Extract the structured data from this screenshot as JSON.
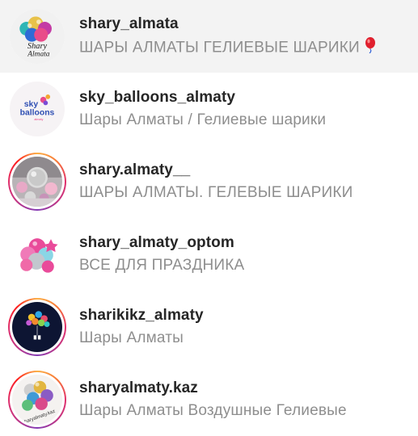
{
  "results": [
    {
      "username": "shary_almata",
      "subtitle": "ШАРЫ АЛМАТЫ ГЕЛИЕВЫЕ ШАРИКИ",
      "has_emoji": true,
      "emoji_icon": "red-balloon-icon",
      "story_ring": false,
      "highlighted": true,
      "avatar_text_lines": [
        "Shary",
        "Almata"
      ]
    },
    {
      "username": "sky_balloons_almaty",
      "subtitle": "Шары Алматы / Гелиевые шарики",
      "has_emoji": false,
      "story_ring": false,
      "highlighted": false,
      "avatar_text_lines": [
        "sky",
        "balloons",
        "almaty"
      ]
    },
    {
      "username": "shary.almaty__",
      "subtitle": "ШАРЫ АЛМАТЫ. ГЕЛЕВЫЕ ШАРИКИ",
      "has_emoji": false,
      "story_ring": true,
      "highlighted": false
    },
    {
      "username": "shary_almaty_optom",
      "subtitle": "ВСЕ ДЛЯ ПРАЗДНИКА",
      "has_emoji": false,
      "story_ring": false,
      "highlighted": false
    },
    {
      "username": "sharikikz_almaty",
      "subtitle": "Шары Алматы",
      "has_emoji": false,
      "story_ring": true,
      "highlighted": false
    },
    {
      "username": "sharyalmaty.kaz",
      "subtitle": "Шары Алматы Воздушные Гелиевые",
      "has_emoji": false,
      "story_ring": true,
      "highlighted": false,
      "avatar_text_lines": [
        "@sharyalmaty.kaz"
      ]
    }
  ]
}
